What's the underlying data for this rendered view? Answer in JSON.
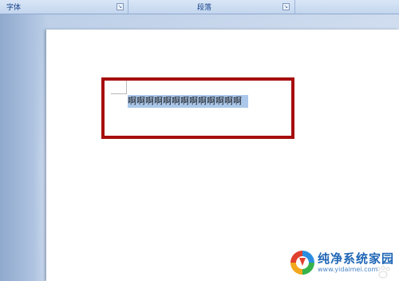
{
  "ribbon": {
    "groups": [
      {
        "label": "字体",
        "launcher": "dialog-launcher-icon"
      },
      {
        "label": "段落",
        "launcher": "dialog-launcher-icon"
      },
      {
        "label": ""
      }
    ]
  },
  "document": {
    "selected_text": "啊啊啊啊啊啊啊啊啊啊啊啊啊",
    "selection_color": "#abc8ea",
    "annotation_color": "#a60e0e"
  },
  "watermark": {
    "title": "纯净系统家园",
    "url": "www.yidaimei.com"
  }
}
